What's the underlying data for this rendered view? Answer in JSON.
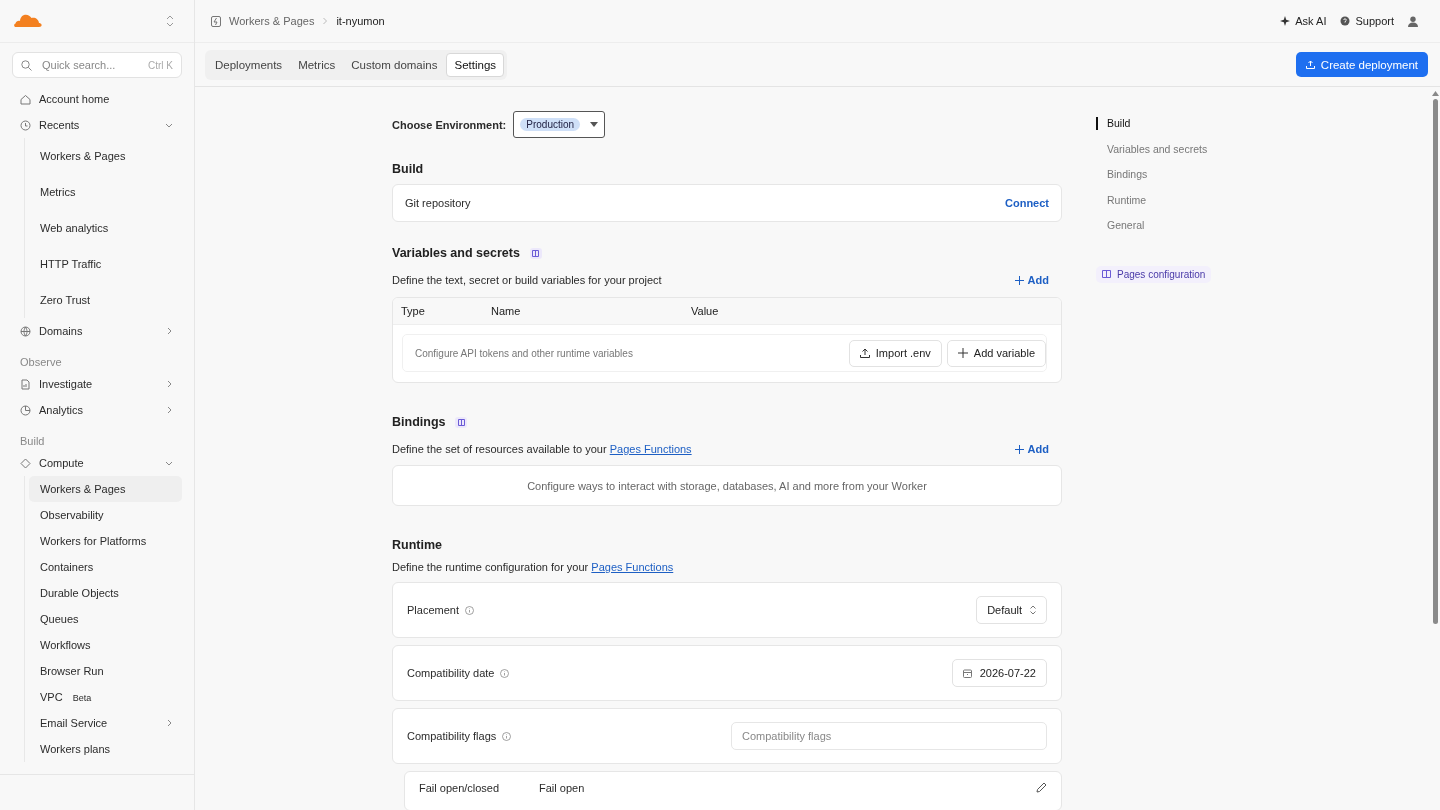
{
  "sidebar": {
    "search": {
      "placeholder": "Quick search...",
      "shortcut": "Ctrl K"
    },
    "items": [
      {
        "kind": "link",
        "label": "Account home"
      },
      {
        "kind": "group",
        "label": "Recents",
        "expanded": true,
        "children": [
          {
            "kind": "link",
            "label": "Workers & Pages",
            "selected": false
          },
          {
            "kind": "link",
            "label": "Metrics",
            "selected": false
          },
          {
            "kind": "link",
            "label": "Web analytics",
            "selected": false
          },
          {
            "kind": "link",
            "label": "HTTP Traffic",
            "selected": false
          },
          {
            "kind": "link",
            "label": "Zero Trust",
            "selected": false
          }
        ]
      },
      {
        "kind": "group",
        "label": "Domains",
        "expanded": false
      },
      {
        "kind": "heading",
        "label": "Observe"
      },
      {
        "kind": "group",
        "label": "Investigate",
        "expanded": false
      },
      {
        "kind": "group",
        "label": "Analytics",
        "expanded": false
      },
      {
        "kind": "heading",
        "label": "Build"
      },
      {
        "kind": "group",
        "label": "Compute",
        "expanded": true,
        "children": [
          {
            "kind": "link",
            "label": "Workers & Pages",
            "selected": true
          },
          {
            "kind": "link",
            "label": "Observability",
            "selected": false
          },
          {
            "kind": "link",
            "label": "Workers for Platforms",
            "selected": false
          },
          {
            "kind": "link",
            "label": "Containers",
            "selected": false
          },
          {
            "kind": "link",
            "label": "Durable Objects",
            "selected": false
          },
          {
            "kind": "link",
            "label": "Queues",
            "selected": false
          },
          {
            "kind": "link",
            "label": "Workflows",
            "selected": false
          },
          {
            "kind": "link",
            "label": "Browser Run",
            "selected": false
          },
          {
            "kind": "link",
            "label": "VPC",
            "badge": "Beta",
            "selected": false
          },
          {
            "kind": "group",
            "label": "Email Service",
            "expanded": false
          },
          {
            "kind": "link",
            "label": "Workers plans",
            "selected": false
          }
        ]
      }
    ]
  },
  "topbar": {
    "breadcrumb": [
      "Workers & Pages",
      "it-nyumon"
    ],
    "actions": [
      "Ask AI",
      "Support"
    ]
  },
  "tabs": [
    {
      "label": "Deployments",
      "selected": false
    },
    {
      "label": "Metrics",
      "selected": false
    },
    {
      "label": "Custom domains",
      "selected": false
    },
    {
      "label": "Settings",
      "selected": true
    }
  ],
  "primary_button": "Create deployment",
  "environment": {
    "label": "Choose Environment:",
    "value": "Production"
  },
  "build": {
    "title": "Build",
    "row_label": "Git repository",
    "action": "Connect"
  },
  "variables": {
    "title": "Variables and secrets",
    "description": "Define the text, secret or build variables for your project",
    "add": "Add",
    "columns": [
      "Type",
      "Name",
      "Value"
    ],
    "empty_text": "Configure API tokens and other runtime variables",
    "buttons": [
      "Import .env",
      "Add variable"
    ]
  },
  "bindings": {
    "title": "Bindings",
    "description": "Define the set of resources available to your",
    "link": "Pages Functions",
    "add": "Add",
    "empty_text": "Configure ways to interact with storage, databases, AI and more from your Worker"
  },
  "runtime": {
    "title": "Runtime",
    "description": "Define the runtime configuration for your",
    "link": "Pages Functions",
    "settings": [
      {
        "kind": "select",
        "label": "Placement",
        "info": true,
        "value": "Default"
      },
      {
        "kind": "date",
        "label": "Compatibility date",
        "info": true,
        "value": "2026-07-22"
      },
      {
        "kind": "input",
        "label": "Compatibility flags",
        "info": true,
        "placeholder": "Compatibility flags"
      },
      {
        "kind": "editable",
        "label": "Fail open/closed",
        "info": false,
        "value": "Fail open"
      }
    ]
  },
  "toc": {
    "items": [
      {
        "label": "Build",
        "selected": true
      },
      {
        "label": "Variables and secrets",
        "selected": false
      },
      {
        "label": "Bindings",
        "selected": false
      },
      {
        "label": "Runtime",
        "selected": false
      },
      {
        "label": "General",
        "selected": false
      }
    ],
    "link": "Pages configuration"
  }
}
